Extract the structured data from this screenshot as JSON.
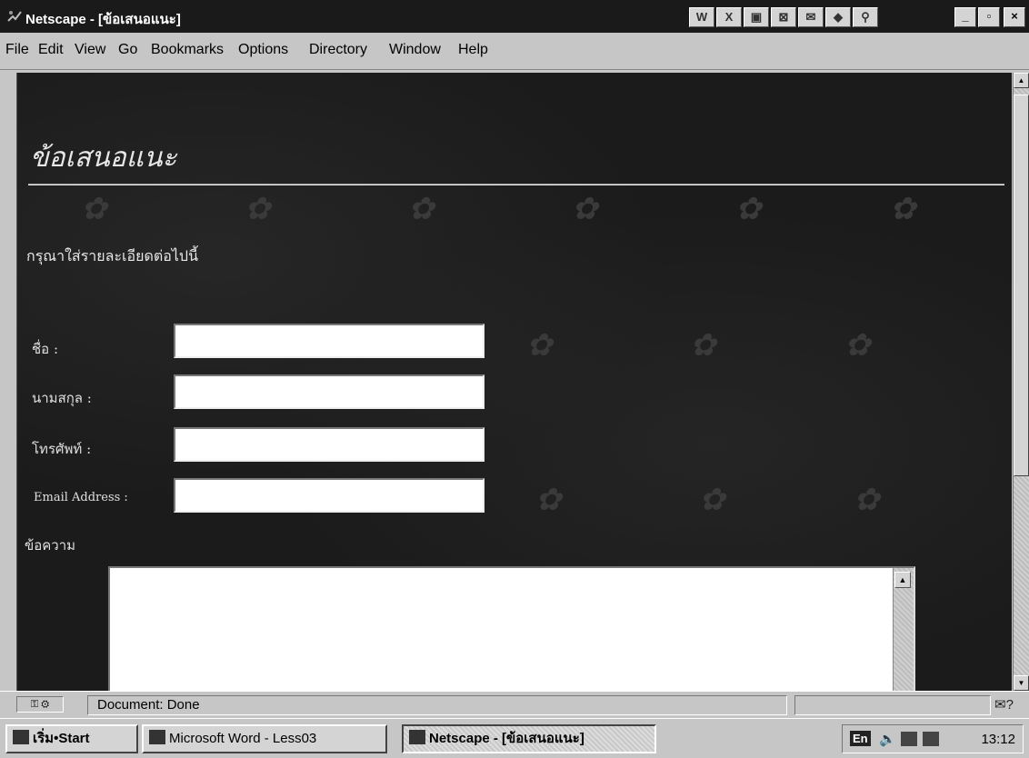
{
  "window": {
    "title": "Netscape - [ข้อเสนอแนะ]"
  },
  "toolbar_icons": [
    "W",
    "X",
    "▣",
    "⊠",
    "✉",
    "◆",
    "⚲"
  ],
  "menu": [
    {
      "label": "File"
    },
    {
      "label": "Edit"
    },
    {
      "label": "View"
    },
    {
      "label": "Go"
    },
    {
      "label": "Bookmarks"
    },
    {
      "label": "Options"
    },
    {
      "label": "Directory"
    },
    {
      "label": "Window"
    },
    {
      "label": "Help"
    }
  ],
  "page": {
    "heading": "ข้อเสนอแนะ",
    "instruction": "กรุณาใส่รายละเอียดต่อไปนี้",
    "fields": [
      {
        "label": "ชื่อ :",
        "value": ""
      },
      {
        "label": "นามสกุล :",
        "value": ""
      },
      {
        "label": "โทรศัพท์ :",
        "value": ""
      },
      {
        "label": "Email Address :",
        "value": ""
      }
    ],
    "message_label": "ข้อความ"
  },
  "status": {
    "text": "Document: Done"
  },
  "taskbar": {
    "start_label": "เริ่ม•Start",
    "tasks": [
      {
        "label": "Microsoft Word - Less03"
      },
      {
        "label": "Netscape - [ข้อเสนอแนะ]"
      }
    ],
    "tray": {
      "lang": "En",
      "clock": "13:12"
    }
  },
  "colors": {
    "titlebar": "#1a1a1a",
    "page_background": "#1b1b1b",
    "page_text": "#e8e8e8",
    "chrome": "#c6c6c6"
  }
}
